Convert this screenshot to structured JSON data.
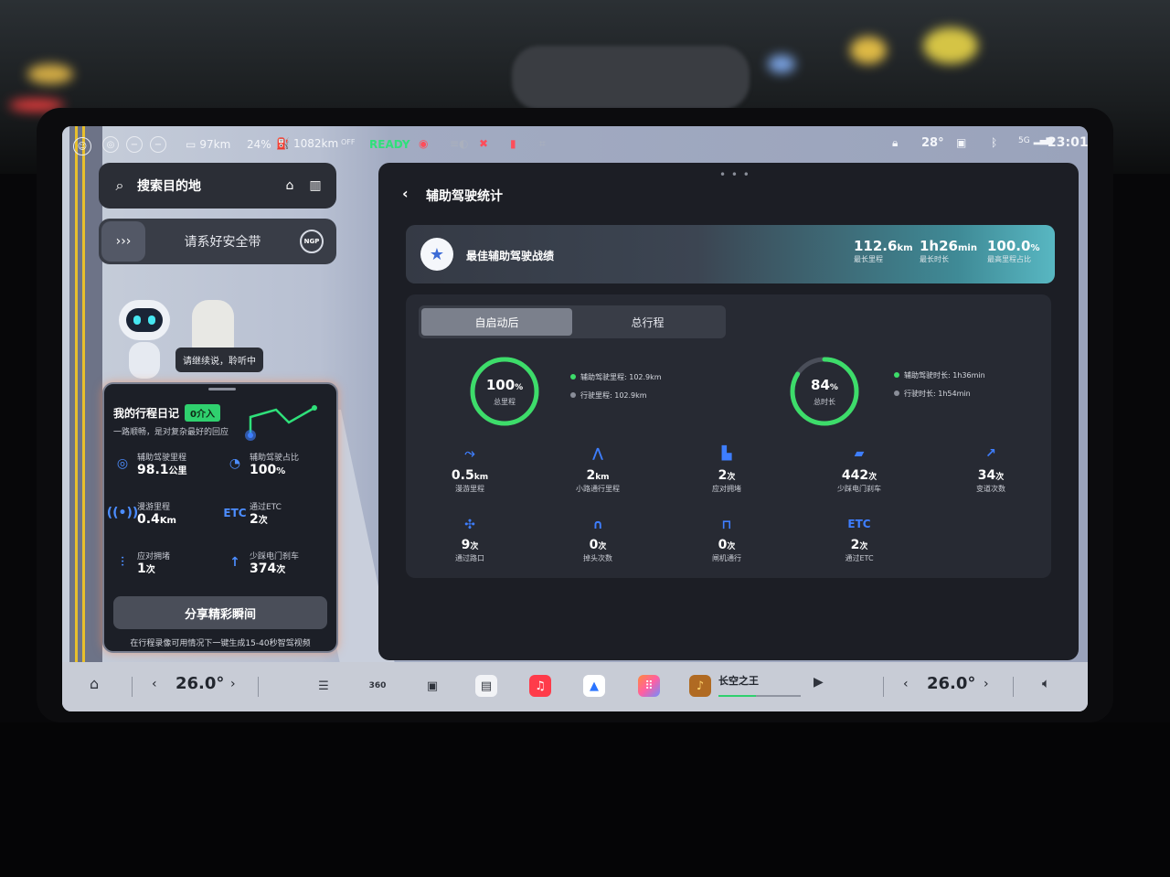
{
  "status_bar": {
    "car_icon_label": "LCC",
    "max_label": "MAX",
    "battery_range": "97km",
    "battery_percent": "24%",
    "fuel_range": "1082km",
    "off_label": "OFF",
    "ready_label": "READY",
    "temperature": "28°",
    "signal_label": "5G",
    "time": "23:01"
  },
  "search": {
    "placeholder": "搜索目的地"
  },
  "belt_notice": {
    "text": "请系好安全带",
    "ngp_label": "NGP"
  },
  "assistant": {
    "bubble": "请继续说，聆听中"
  },
  "trip_diary": {
    "title": "我的行程日记",
    "badge": "0介入",
    "subtitle": "一路顺畅，是对复杂最好的回应",
    "items": [
      {
        "icon": "steering-wheel-icon",
        "label": "辅助驾驶里程",
        "value": "98.1",
        "unit": "公里"
      },
      {
        "icon": "pie-ratio-icon",
        "label": "辅助驾驶占比",
        "value": "100",
        "unit": "%"
      },
      {
        "icon": "wireless-icon",
        "label": "漫游里程",
        "value": "0.4",
        "unit": "Km"
      },
      {
        "icon": "etc-icon",
        "label": "通过ETC",
        "value": "2",
        "unit": "次"
      },
      {
        "icon": "congestion-icon",
        "label": "应对拥堵",
        "value": "1",
        "unit": "次"
      },
      {
        "icon": "arrow-up-icon",
        "label": "少踩电门刹车",
        "value": "374",
        "unit": "次"
      }
    ],
    "share_button": "分享精彩瞬间",
    "hint": "在行程录像可用情况下一键生成15-40秒智驾视频"
  },
  "panel": {
    "title": "辅助驾驶统计",
    "best": {
      "name": "最佳辅助驾驶战绩",
      "stats": [
        {
          "value": "112.6",
          "unit": "km",
          "label": "最长里程"
        },
        {
          "value": "1h26",
          "unit": "min",
          "label": "最长时长"
        },
        {
          "value": "100.0",
          "unit": "%",
          "label": "最高里程占比"
        }
      ]
    },
    "tabs": [
      "自启动后",
      "总行程"
    ],
    "ring_mileage": {
      "value": "100",
      "unit": "%",
      "label": "总里程",
      "fraction": 1.0
    },
    "ring_duration": {
      "value": "84",
      "unit": "%",
      "label": "总时长",
      "fraction": 0.84
    },
    "mileage_legend": [
      "辅助驾驶里程: 102.9km",
      "行驶里程: 102.9km"
    ],
    "duration_legend": [
      "辅助驾驶时长: 1h36min",
      "行驶时长: 1h54min"
    ],
    "stats": [
      {
        "icon": "roam-route-icon",
        "value": "0.5",
        "unit": "km",
        "label": "漫游里程"
      },
      {
        "icon": "narrow-road-icon",
        "value": "2",
        "unit": "km",
        "label": "小路通行里程"
      },
      {
        "icon": "traffic-car-icon",
        "value": "2",
        "unit": "次",
        "label": "应对拥堵"
      },
      {
        "icon": "pedal-icon",
        "value": "442",
        "unit": "次",
        "label": "少踩电门刹车"
      },
      {
        "icon": "lane-change-icon",
        "value": "34",
        "unit": "次",
        "label": "变道次数"
      },
      {
        "icon": "intersection-icon",
        "value": "9",
        "unit": "次",
        "label": "通过路口"
      },
      {
        "icon": "u-turn-icon",
        "value": "0",
        "unit": "次",
        "label": "掉头次数"
      },
      {
        "icon": "gate-icon",
        "value": "0",
        "unit": "次",
        "label": "闸机通行"
      },
      {
        "icon": "etc-icon",
        "value": "2",
        "unit": "次",
        "label": "通过ETC"
      }
    ]
  },
  "dock": {
    "temp_left": "26.0°",
    "temp_right": "26.0°",
    "camera_label": "360",
    "music_title": "长空之王",
    "music_progress": 0.45
  },
  "colors": {
    "accent_green": "#2fe07a",
    "ring_green": "#3ddc6a",
    "ring_track": "#4a4e59",
    "icon_blue": "#3e7eff"
  }
}
